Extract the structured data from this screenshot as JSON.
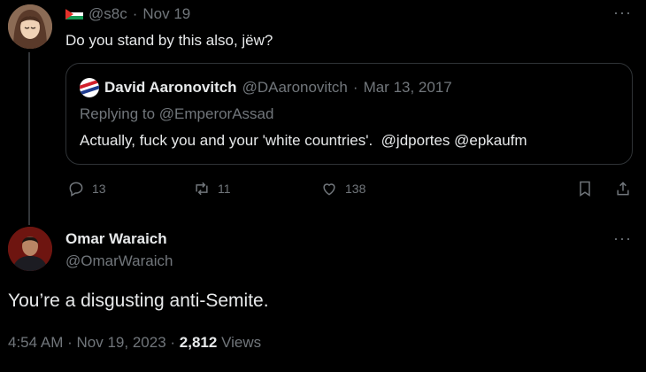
{
  "reply": {
    "handle": "@s8c",
    "separator": "·",
    "date": "Nov 19",
    "text": "Do you stand by this also, jëw?",
    "more": "···"
  },
  "quote": {
    "author_name": "David Aaronovitch",
    "author_handle": "@DAaronovitch",
    "separator": "·",
    "date": "Mar 13, 2017",
    "replying_to": "Replying to @EmperorAssad",
    "text": "Actually, fuck you and your 'white countries'.  @jdportes @epkaufm"
  },
  "actions": {
    "replies": "13",
    "reposts": "11",
    "likes": "138",
    "icons": [
      "reply-icon",
      "repost-icon",
      "like-icon",
      "bookmark-icon",
      "share-icon"
    ]
  },
  "main": {
    "name": "Omar Waraich",
    "handle": "@OmarWaraich",
    "more": "···",
    "text": "You’re a disgusting anti-Semite.",
    "time": "4:54 AM",
    "sep1": "·",
    "date": "Nov 19, 2023",
    "sep2": "·",
    "views_count": "2,812",
    "views_label": "Views"
  },
  "colors": {
    "background": "#000000",
    "text": "#e7e9ea",
    "muted": "#71767b",
    "border": "#2f3336"
  }
}
